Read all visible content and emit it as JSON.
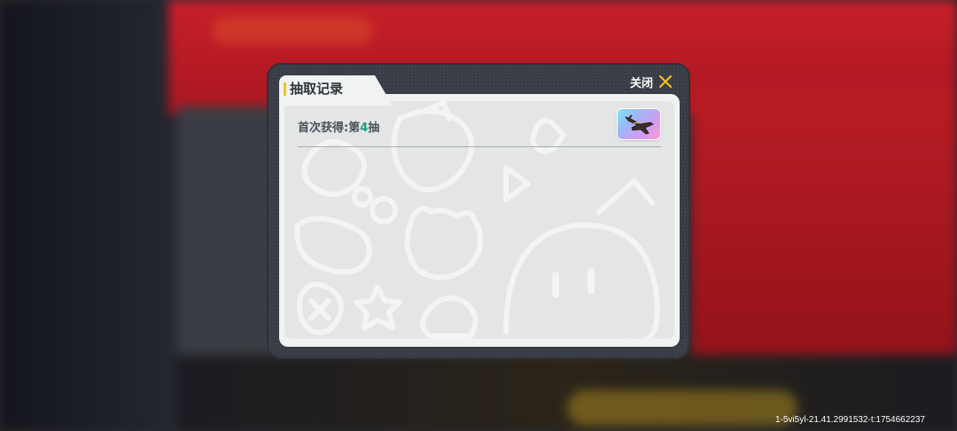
{
  "dialog": {
    "title": "抽取记录",
    "close_label": "关闭",
    "record": {
      "prefix": "首次获得:第",
      "draw_number": "4",
      "suffix": "抽"
    },
    "item_icon": "airplane-item-icon"
  },
  "colors": {
    "accent_yellow": "#f3c021",
    "number_green": "#17a37a",
    "dialog_frame": "#383c44",
    "panel_bg": "#f1f2f2"
  },
  "footer": {
    "build_id": "1-5vi5yl-21.41.2991532-t:1754662237"
  }
}
